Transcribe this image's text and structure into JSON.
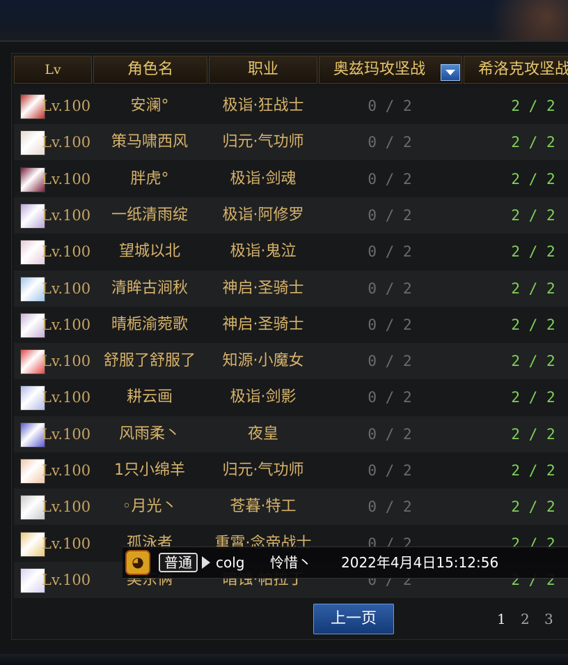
{
  "table": {
    "headers": [
      "Lv",
      "角色名",
      "职业",
      "奥兹玛攻坚战",
      "希洛克攻坚战"
    ],
    "rows": [
      {
        "lv": "Lv.100",
        "name": "安澜°",
        "job": "极诣·狂战士",
        "ozma": "0 / 2",
        "sirocco": "2 / 2",
        "avatar": "#c0322a"
      },
      {
        "lv": "Lv.100",
        "name": "策马啸西风",
        "job": "归元·气功师",
        "ozma": "0 / 2",
        "sirocco": "2 / 2",
        "avatar": "#e8d8d0"
      },
      {
        "lv": "Lv.100",
        "name": "胖虎°",
        "job": "极诣·剑魂",
        "ozma": "0 / 2",
        "sirocco": "2 / 2",
        "avatar": "#7a1e3a"
      },
      {
        "lv": "Lv.100",
        "name": "一纸清雨绽",
        "job": "极诣·阿修罗",
        "ozma": "0 / 2",
        "sirocco": "2 / 2",
        "avatar": "#b9a6d8"
      },
      {
        "lv": "Lv.100",
        "name": "望城以北",
        "job": "极诣·鬼泣",
        "ozma": "0 / 2",
        "sirocco": "2 / 2",
        "avatar": "#e6c8d8"
      },
      {
        "lv": "Lv.100",
        "name": "清眸古涧秋",
        "job": "神启·圣骑士",
        "ozma": "0 / 2",
        "sirocco": "2 / 2",
        "avatar": "#9ec4ea"
      },
      {
        "lv": "Lv.100",
        "name": "晴栀渝菀歌",
        "job": "神启·圣骑士",
        "ozma": "0 / 2",
        "sirocco": "2 / 2",
        "avatar": "#c6b0d6"
      },
      {
        "lv": "Lv.100",
        "name": "舒服了舒服了",
        "job": "知源·小魔女",
        "ozma": "0 / 2",
        "sirocco": "2 / 2",
        "avatar": "#e04848"
      },
      {
        "lv": "Lv.100",
        "name": "耕云画",
        "job": "极诣·剑影",
        "ozma": "0 / 2",
        "sirocco": "2 / 2",
        "avatar": "#b0b8e8"
      },
      {
        "lv": "Lv.100",
        "name": "风雨柔丶",
        "job": "夜皇",
        "ozma": "0 / 2",
        "sirocco": "2 / 2",
        "avatar": "#5a5ad0"
      },
      {
        "lv": "Lv.100",
        "name": "1只小绵羊",
        "job": "归元·气功师",
        "ozma": "0 / 2",
        "sirocco": "2 / 2",
        "avatar": "#f0c6a8"
      },
      {
        "lv": "Lv.100",
        "name": "◦月光丶",
        "job": "苍暮·特工",
        "ozma": "0 / 2",
        "sirocco": "2 / 2",
        "avatar": "#c8c8c8"
      },
      {
        "lv": "Lv.100",
        "name": "孤泳者",
        "job": "重霄·念帝战士",
        "ozma": "0 / 2",
        "sirocco": "2 / 2",
        "avatar": "#e8c878"
      },
      {
        "lv": "Lv.100",
        "name": "昊东俩",
        "job": "暗蚀·帕拉丁",
        "ozma": "0 / 2",
        "sirocco": "2 / 2",
        "avatar": "#d8d0f0"
      }
    ]
  },
  "chat": {
    "channel": "普通",
    "icon": "😀",
    "sender": "colg",
    "message": "怜惜丶",
    "timestamp": "2022年4月4日15:12:56"
  },
  "pagination": {
    "prev_label": "上一页",
    "pages": [
      "1",
      "2",
      "3"
    ],
    "current": "1"
  },
  "colors": {
    "header_text": "#e6c56c",
    "name_text": "#d6b36b",
    "ozma_text": "#6a6c6e",
    "sirocco_text": "#7fd35a"
  }
}
